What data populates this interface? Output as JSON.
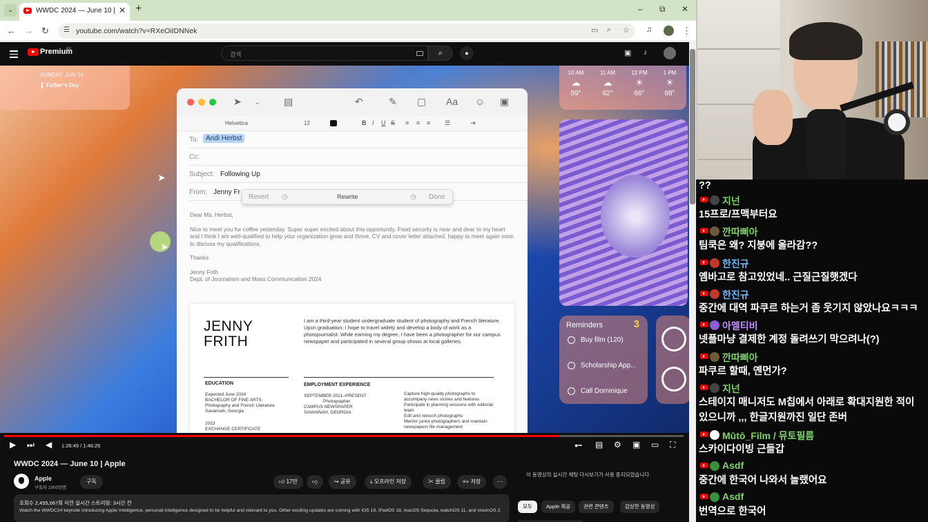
{
  "browser": {
    "tab_title": "WWDC 2024 — June 10 |",
    "url": "youtube.com/watch?v=RXeOiIDNNek",
    "win_min": "–",
    "win_max": "⧉",
    "win_close": "✕",
    "new_tab": "+",
    "tab_close": "✕"
  },
  "youtube": {
    "brand": "Premium",
    "brand_region": "KR",
    "search_placeholder": "검색"
  },
  "video": {
    "calendar_date": "SUNDAY, JUN 16",
    "calendar_event": "Father's Day",
    "weather": [
      {
        "time": "10 AM",
        "icon": "☁",
        "deg": "59°"
      },
      {
        "time": "11 AM",
        "icon": "☁",
        "deg": "62°"
      },
      {
        "time": "12 PM",
        "icon": "☀",
        "deg": "66°"
      },
      {
        "time": "1 PM",
        "icon": "☀",
        "deg": "68°"
      }
    ],
    "reminders": {
      "title": "Reminders",
      "count": "3",
      "items": [
        "Buy film (120)",
        "Scholarship App...",
        "Call Dominique"
      ]
    },
    "mail": {
      "font": "Helvetica",
      "size": "12",
      "to_label": "To:",
      "to_value": "Andi Herbst",
      "cc_label": "Cc:",
      "subject_label": "Subject:",
      "subject_value": "Following Up",
      "from_label": "From:",
      "from_value": "Jenny Fr",
      "revert": "Revert",
      "rewrite": "Rewrite",
      "done": "Done",
      "greeting": "Dear Ms. Herbst,",
      "paragraph": "Nice to meet you for coffee yesterday. Super super excited about this opportunity. Food security is near and dear to my heart and I think I am well-qualified to help your organization grow and thrive. CV and cover letter attached, happy to meet again soon to discuss my qualifications.",
      "thanks": "Thanks",
      "sign_name": "Jenny Frith",
      "sign_dept": "Dept. of Journalism and Mass Communication 2024"
    },
    "resume": {
      "name_first": "JENNY",
      "name_last": "FRITH",
      "intro": "I am a third-year student undergraduate student of photography and French literature. Upon graduation, I hope to travel widely and develop a body of work as a photojournalist. While earning my degree, I have been a photographer for our campus newspaper and participated in several group shows at local galleries.",
      "education_h": "EDUCATION",
      "education_1": "Expected June 2024",
      "education_2": "BACHELOR OF FINE ARTS",
      "education_3": "Photography and French Literature",
      "education_4": "Savannah, Georgia",
      "education_5": "2023",
      "education_6": "EXCHANGE CERTIFICATE",
      "exp_h": "EMPLOYMENT EXPERIENCE",
      "exp_1": "SEPTEMBER 2021–PRESENT",
      "exp_2": "Photographer",
      "exp_3": "CAMPUS NEWSPAPER",
      "exp_4": "SAVANNAH, GEORGIA",
      "bullets": [
        "Capture high-quality photographs to accompany news stories and features",
        "Participate in planning sessions with editorial team",
        "Edit and retouch photographs",
        "Mentor junior photographers and maintain newspapers file management"
      ]
    },
    "time": "1:26:49 / 1:46:25",
    "progress": 0.816
  },
  "below": {
    "title": "WWDC 2024 — June 10 | Apple",
    "channel": "Apple",
    "subs": "구독자 1900만명",
    "subscribe": "구독",
    "likes": "17만",
    "share": "공유",
    "offline": "오프라인 저장",
    "clip": "클립",
    "save": "저장",
    "more": "···",
    "desc_line1": "조회수 2,455,067회  이전 실시간 스트리밍: 3시간 전",
    "desc_line2": "Watch the WWDC24 keynote introducing Apple Intelligence, personal intelligence designed to be helpful and relevant to you. Other exciting updates are coming with iOS 18, iPadOS 18, macOS Sequoia, watchOS 11, and visionOS 2.",
    "chat_notice": "이 동영상의 실시간 채팅 다시보기가 사용 중지되었습니다.",
    "chips": [
      "모두",
      "Apple 제공",
      "관련 콘텐츠",
      "감상한 동영상"
    ]
  },
  "chat": [
    {
      "nick": "",
      "text": "??",
      "color": "#ffffff",
      "avatar": ""
    },
    {
      "nick": "지넌",
      "text": "15프로/프맥부터요",
      "color": "#7fd36a",
      "avatar": "#444"
    },
    {
      "nick": "깐따삐아",
      "text": "팀쿡은 왜? 지붕에 올라감??",
      "color": "#7fd36a",
      "avatar": "#6c5a3a"
    },
    {
      "nick": "한진규",
      "text": "옘바고로 참고있었네.. 근질근질햇겠다",
      "color": "#6fb8ff",
      "avatar": "#c0392b"
    },
    {
      "nick": "한진규",
      "text": "중간에 대역 파쿠르 하는거 좀 웃기지 않았나요ㅋㅋㅋ",
      "color": "#6fb8ff",
      "avatar": "#c0392b"
    },
    {
      "nick": "아멜티비",
      "text": "넷플마냥 결제한 계정 돌려쓰기 막으려나(?)",
      "color": "#c28bff",
      "avatar": "#8e5bd6"
    },
    {
      "nick": "깐따삐아",
      "text": "파쿠르 할때, 옌먼가?",
      "color": "#7fd36a",
      "avatar": "#6c5a3a"
    },
    {
      "nick": "지넌",
      "text": "스테이지 매니저도 M칩에서 아래로 확대지원한 적이",
      "text2": "있으니까 ,,, 한글지원까진 일단 존버",
      "color": "#7fd36a",
      "avatar": "#444"
    },
    {
      "nick": "Mūtō_Film / 뮤토필름",
      "text": "스카이다이빙 근들갑",
      "color": "#7fd36a",
      "avatar": "#ffffff"
    },
    {
      "nick": "Asdf",
      "text": "중간에 한국어 나와서 놀랬어요",
      "color": "#7fd36a",
      "avatar": "#3a8f3a"
    },
    {
      "nick": "Asdf",
      "text": "번역으로 한국어",
      "color": "#7fd36a",
      "avatar": "#3a8f3a"
    }
  ]
}
